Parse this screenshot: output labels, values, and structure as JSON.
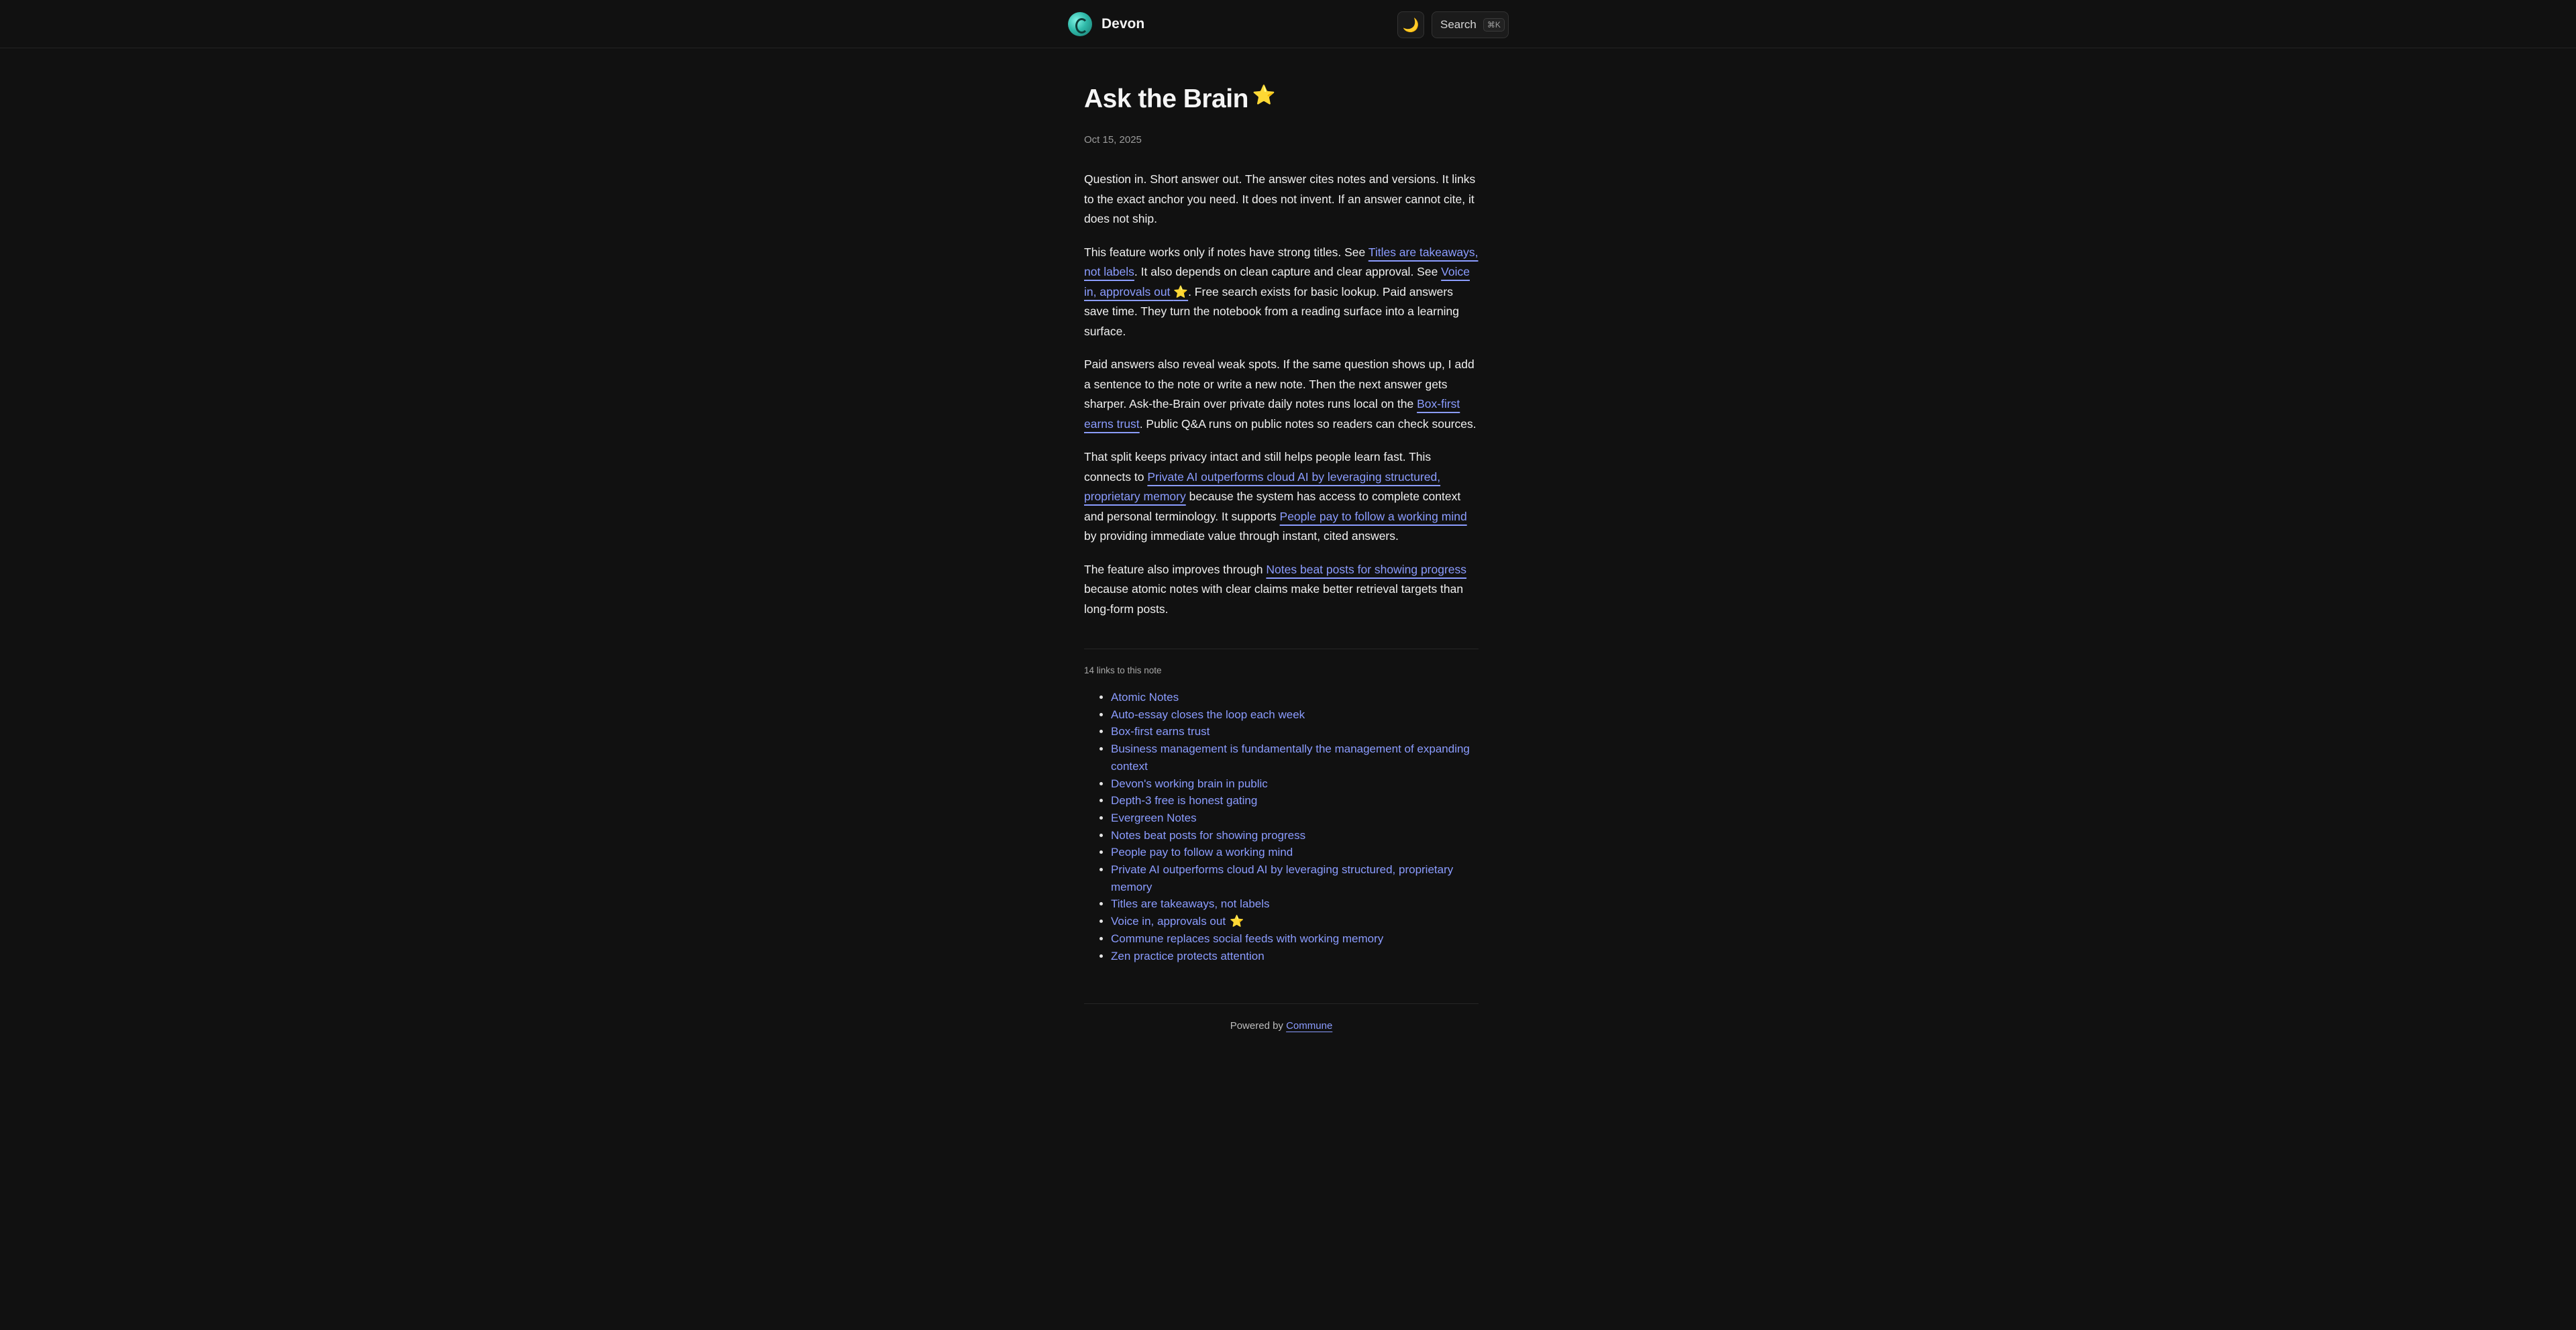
{
  "header": {
    "brand_name": "Devon",
    "theme_icon": "moon-icon",
    "theme_glyph": "🌙",
    "search_label": "Search",
    "search_shortcut": "⌘K"
  },
  "article": {
    "title": "Ask the Brain",
    "title_star": "⭐",
    "date": "Oct 15, 2025",
    "p1": "Question in. Short answer out. The answer cites notes and versions. It links to the exact anchor you need. It does not invent. If an answer cannot cite, it does not ship.",
    "p2": {
      "t1": "This feature works only if notes have strong titles. See ",
      "link1": "Titles are takeaways, not labels",
      "t2": ". It also depends on clean capture and clear approval. See ",
      "link2": "Voice in, approvals out ",
      "link2_star": "⭐",
      "t3": ". Free search exists for basic lookup. Paid answers save time. They turn the notebook from a reading surface into a learning surface."
    },
    "p3": {
      "t1": "Paid answers also reveal weak spots. If the same question shows up, I add a sentence to the note or write a new note. Then the next answer gets sharper. Ask-the-Brain over private daily notes runs local on the ",
      "link1": "Box-first earns trust",
      "t2": ". Public Q&A runs on public notes so readers can check sources."
    },
    "p4": {
      "t1": "That split keeps privacy intact and still helps people learn fast. This connects to ",
      "link1": "Private AI outperforms cloud AI by leveraging structured, proprietary memory",
      "t2": " because the system has access to complete context and personal terminology. It supports ",
      "link2": "People pay to follow a working mind",
      "t3": " by providing immediate value through instant, cited answers."
    },
    "p5": {
      "t1": "The feature also improves through ",
      "link1": "Notes beat posts for showing progress",
      "t2": " because atomic notes with clear claims make better retrieval targets than long-form posts."
    }
  },
  "backlinks": {
    "heading": "14 links to this note",
    "items": [
      {
        "label": "Atomic Notes",
        "star": ""
      },
      {
        "label": "Auto-essay closes the loop each week",
        "star": ""
      },
      {
        "label": "Box-first earns trust",
        "star": ""
      },
      {
        "label": "Business management is fundamentally the management of expanding context",
        "star": ""
      },
      {
        "label": "Devon's working brain in public",
        "star": ""
      },
      {
        "label": "Depth-3 free is honest gating",
        "star": ""
      },
      {
        "label": "Evergreen Notes",
        "star": ""
      },
      {
        "label": "Notes beat posts for showing progress",
        "star": ""
      },
      {
        "label": "People pay to follow a working mind",
        "star": ""
      },
      {
        "label": "Private AI outperforms cloud AI by leveraging structured, proprietary memory",
        "star": ""
      },
      {
        "label": "Titles are takeaways, not labels",
        "star": ""
      },
      {
        "label": "Voice in, approvals out",
        "star": "⭐"
      },
      {
        "label": "Commune replaces social feeds with working memory",
        "star": ""
      },
      {
        "label": "Zen practice protects attention",
        "star": ""
      }
    ]
  },
  "footer": {
    "powered_by": "Powered by ",
    "link": "Commune"
  },
  "colors": {
    "background": "#111111",
    "link": "#8b9cff",
    "text": "#f0f0f0"
  }
}
